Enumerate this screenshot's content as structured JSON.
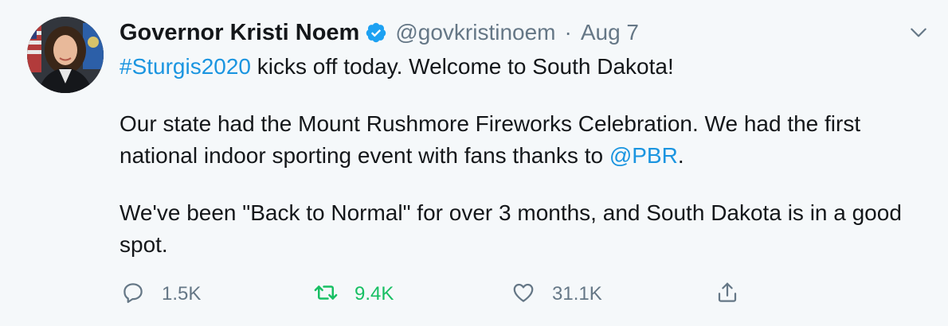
{
  "author": {
    "name": "Governor Kristi Noem",
    "handle": "@govkristinoem",
    "separator": "·",
    "date": "Aug 7",
    "verified": true
  },
  "tweet": {
    "line1_hashtag": "#Sturgis2020",
    "line1_text": " kicks off today. Welcome to South Dakota!",
    "para2_text_a": "Our state had the Mount Rushmore Fireworks Celebration. We had the first national indoor sporting event with fans thanks to ",
    "para2_mention": "@PBR",
    "para2_text_b": ".",
    "para3_text": "We've been \"Back to Normal\" for over 3 months, and South Dakota is in a good spot."
  },
  "actions": {
    "reply_count": "1.5K",
    "retweet_count": "9.4K",
    "like_count": "31.1K"
  },
  "colors": {
    "background": "#f5f8fa",
    "link": "#1b95e0",
    "muted": "#657786",
    "retweet": "#17bf63",
    "verified": "#1da1f2"
  },
  "icons": [
    "verified-badge-icon",
    "caret-down-icon",
    "reply-icon",
    "retweet-icon",
    "like-icon",
    "share-icon"
  ]
}
